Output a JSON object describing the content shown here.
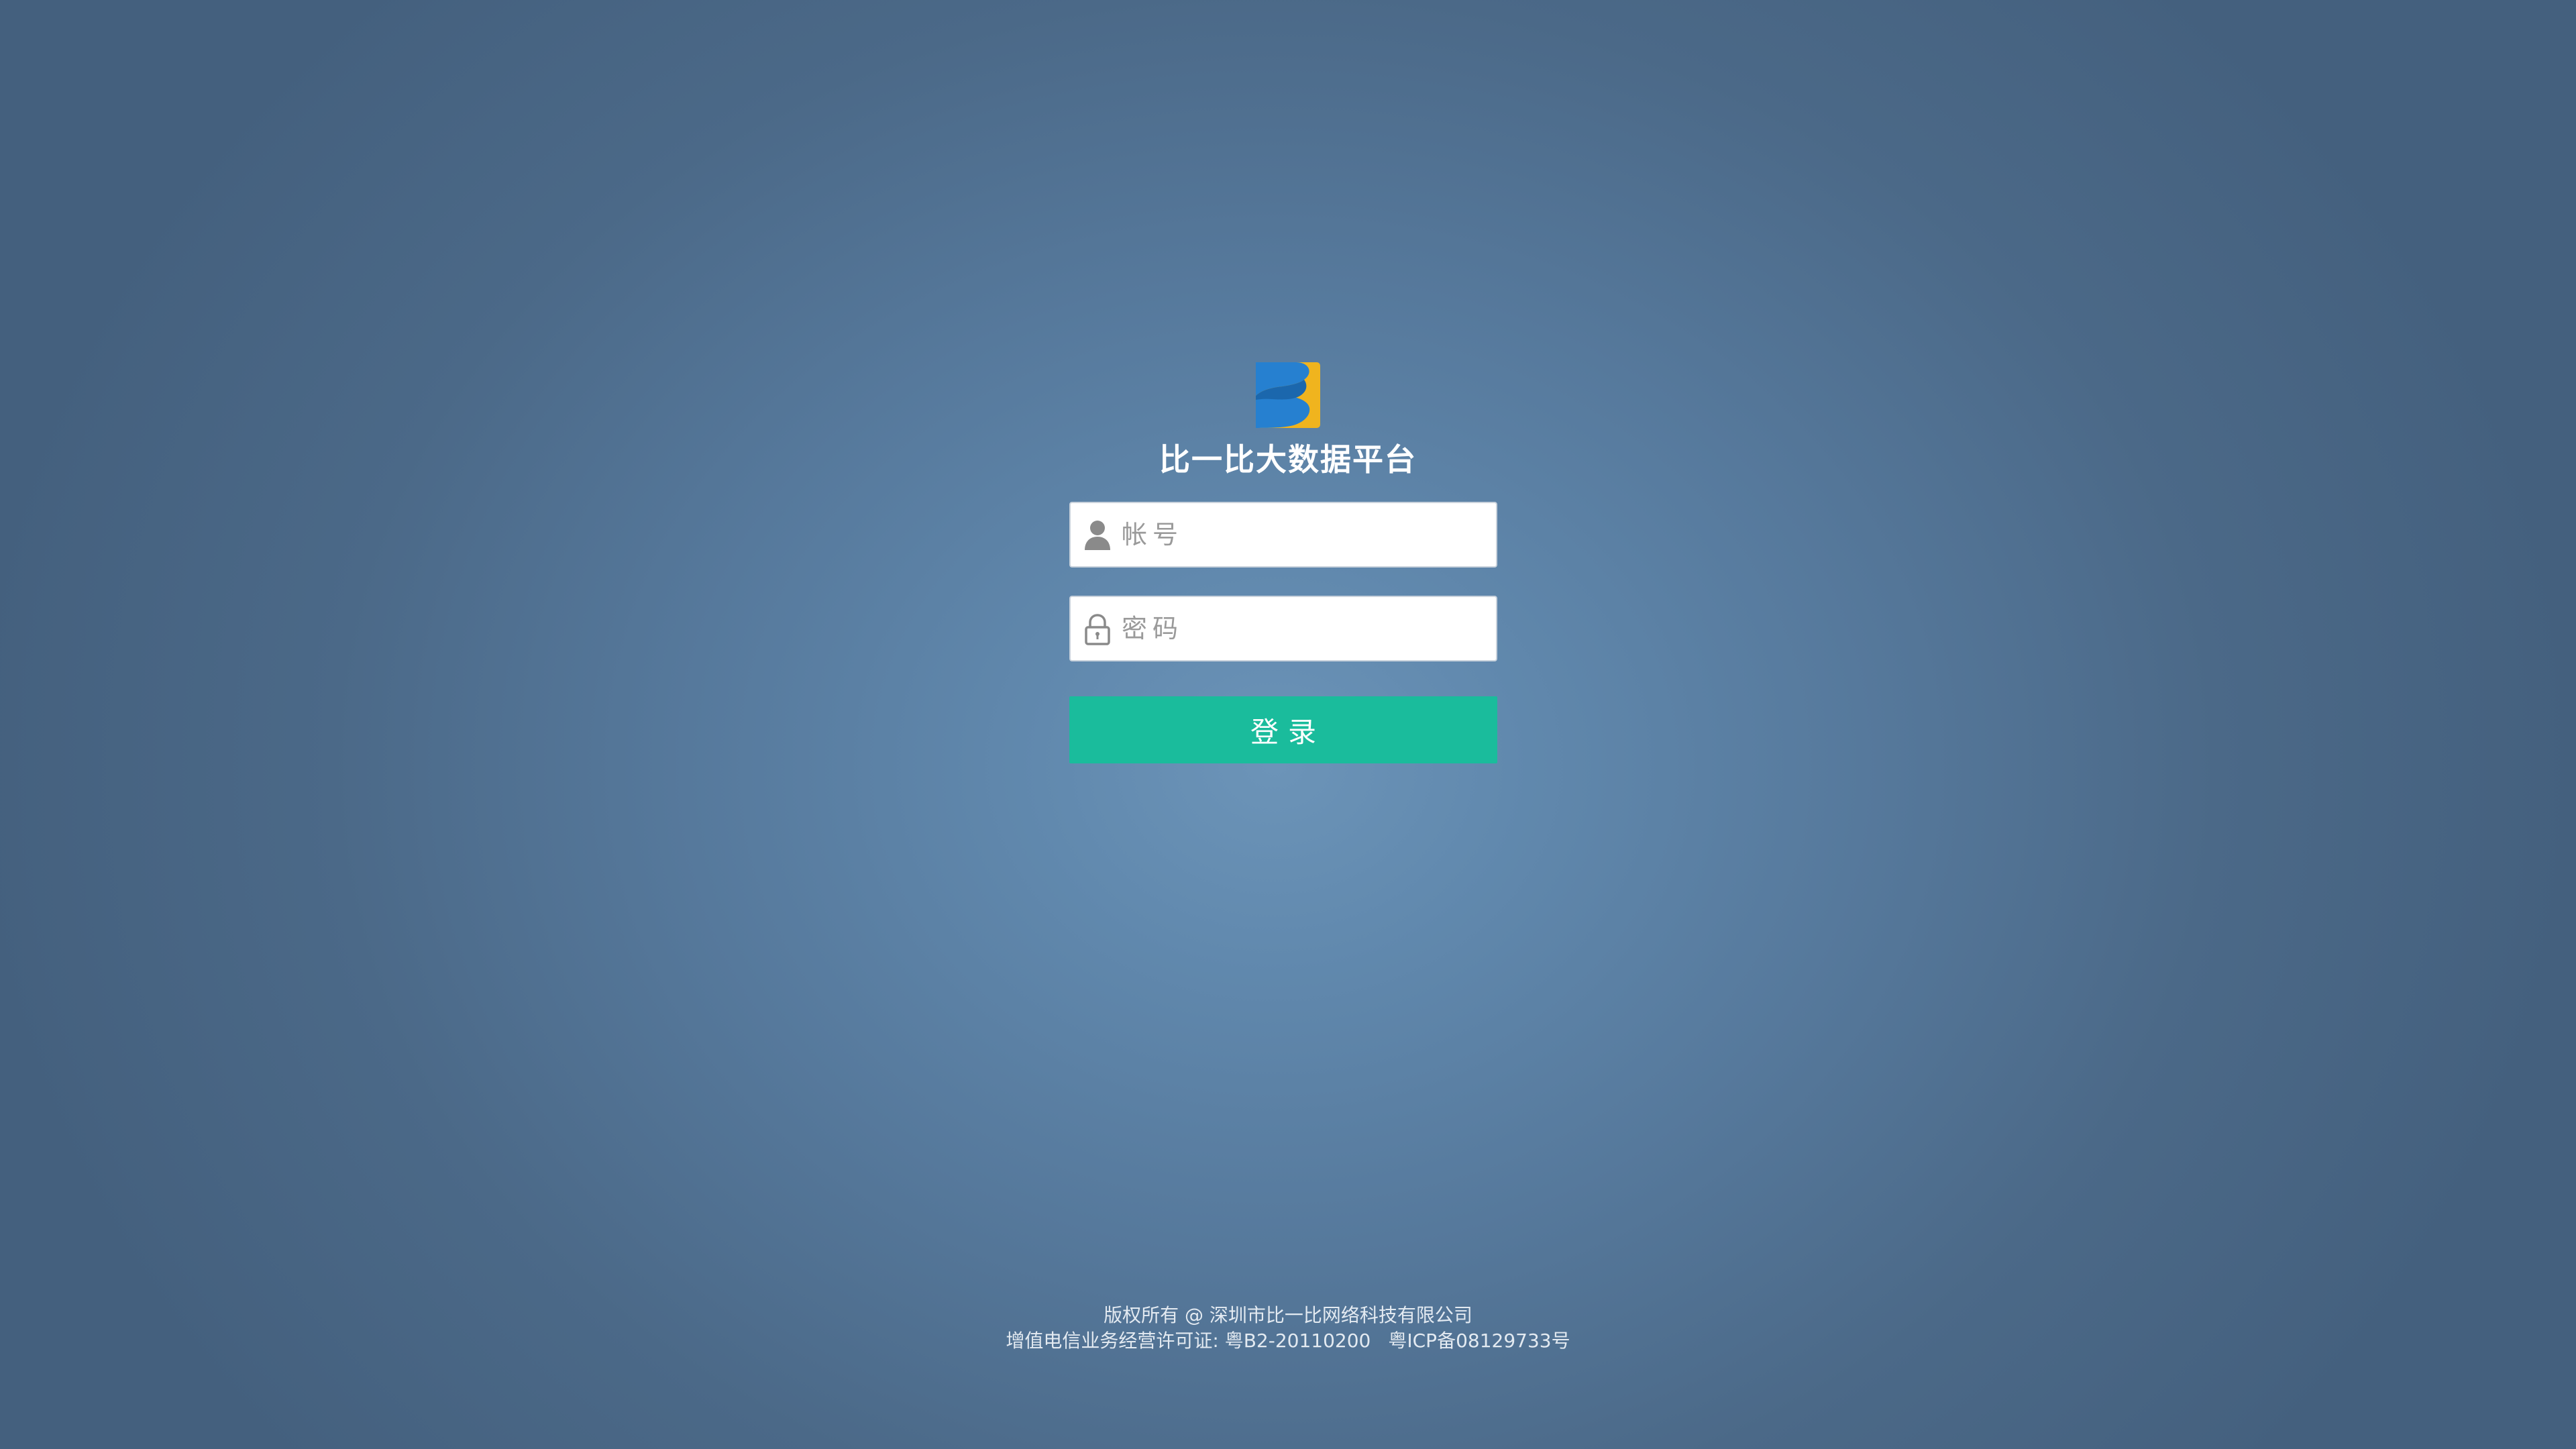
{
  "app": {
    "title": "比一比大数据平台",
    "logo_icon": "bibi-logo-icon",
    "colors": {
      "background_center": "#6c94b8",
      "background_edge": "#44607e",
      "logo_blue": "#2680d0",
      "logo_yellow": "#f0b41e",
      "button": "#1abc9c"
    }
  },
  "login_form": {
    "account": {
      "icon": "user-icon",
      "placeholder": "帐号",
      "value": ""
    },
    "password": {
      "icon": "lock-icon",
      "placeholder": "密码",
      "value": ""
    },
    "submit_label": "登录"
  },
  "footer": {
    "copyright": "版权所有 @ 深圳市比一比网络科技有限公司",
    "license": "增值电信业务经营许可证: 粤B2-20110200",
    "icp": "粤ICP备08129733号"
  }
}
